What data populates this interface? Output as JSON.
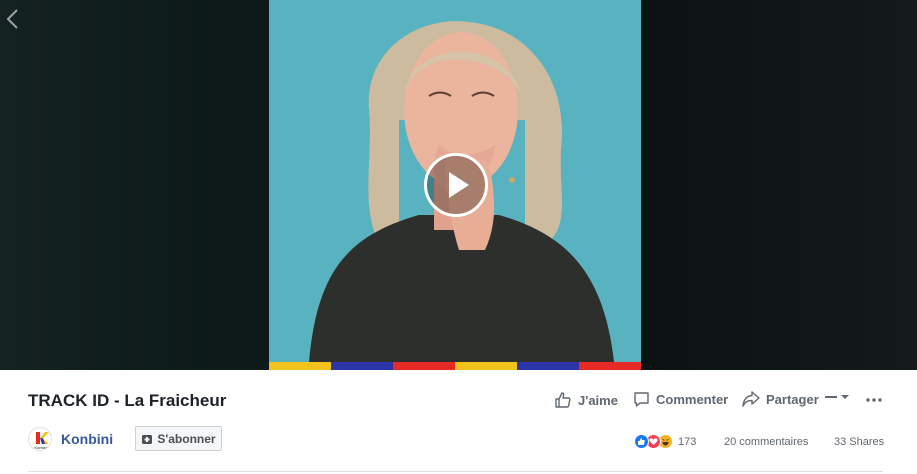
{
  "video": {
    "title": "TRACK ID - La Fraicheur",
    "stripe_colors": [
      "#f2c31b",
      "#2b35a8",
      "#e82a27",
      "#f2c31b",
      "#2b35a8",
      "#e82a27"
    ],
    "background_color": "#58b2bf"
  },
  "actions": {
    "like_label": "J'aime",
    "comment_label": "Commenter",
    "share_label": "Partager"
  },
  "page": {
    "name": "Konbini",
    "logo_text": "Konbini",
    "subscribe_label": "S'abonner"
  },
  "stats": {
    "reactions_count": "173",
    "comments": "20 commentaires",
    "shares": "33 Shares"
  },
  "colors": {
    "like": "#1877f2",
    "love": "#f33e58",
    "haha": "#f7b125",
    "link": "#385898"
  }
}
